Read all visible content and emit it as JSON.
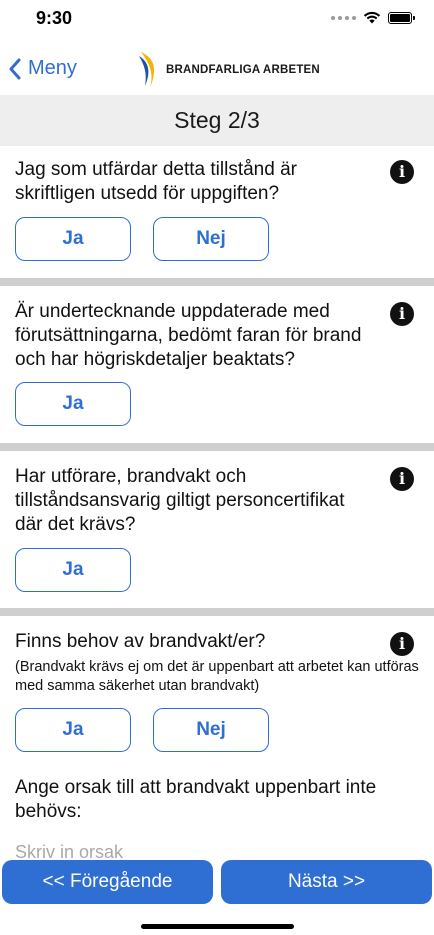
{
  "status_bar": {
    "time": "9:30"
  },
  "nav": {
    "back_label": "Meny",
    "brand": "BRANDFARLIGA ARBETEN"
  },
  "step": {
    "title": "Steg 2/3"
  },
  "questions": [
    {
      "text": "Jag som utfärdar detta tillstånd är skriftligen utsedd för uppgiften?",
      "yes": "Ja",
      "no": "Nej"
    },
    {
      "text": "Är undertecknande uppdaterade med förutsättningarna, bedömt faran för brand och har högriskdetaljer beaktats?",
      "yes": "Ja"
    },
    {
      "text": "Har utförare, brandvakt och tillståndsansvarig giltigt personcertifikat där det krävs?",
      "yes": "Ja"
    },
    {
      "text": "Finns behov av brandvakt/er?",
      "note": "(Brandvakt krävs ej om det är uppenbart att arbetet kan utföras med samma säkerhet utan brandvakt)",
      "yes": "Ja",
      "no": "Nej"
    }
  ],
  "reason": {
    "label": "Ange orsak till att brandvakt uppenbart inte behövs:",
    "placeholder": "Skriv in orsak",
    "value": ""
  },
  "footer": {
    "prev_label": "<< Föregående",
    "next_label": "Nästa >>"
  },
  "colors": {
    "accent": "#2f6fd3",
    "divider": "#cfcfcf",
    "header_bg": "#eeeeee"
  }
}
